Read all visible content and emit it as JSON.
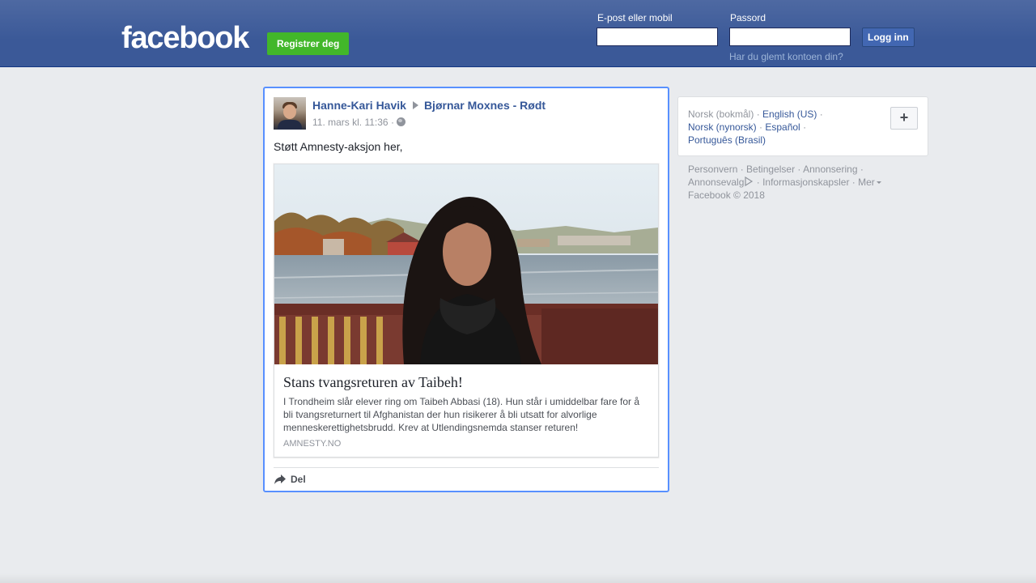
{
  "header": {
    "logo_text": "facebook",
    "register_label": "Registrer deg",
    "email_label": "E-post eller mobil",
    "email_value": "",
    "password_label": "Passord",
    "password_value": "",
    "login_label": "Logg inn",
    "forgot_label": "Har du glemt kontoen din?"
  },
  "post": {
    "author": "Hanne-Kari Havik",
    "target": "Bjørnar Moxnes - Rødt",
    "timestamp": "11. mars kl. 11:36",
    "meta_separator": "·",
    "text": "Støtt Amnesty-aksjon her,",
    "link": {
      "title": "Stans tvangsreturen av Taibeh!",
      "description": "I Trondheim slår elever ring om Taibeh Abbasi (18). Hun står i umiddelbar fare for å bli tvangsreturnert til Afghanistan der hun risikerer å bli utsatt for alvorlige menneskerettighetsbrudd. Krev at Utlendingsnemda stanser returen!",
      "domain": "AMNESTY.NO"
    },
    "share_label": "Del"
  },
  "languages": {
    "current": "Norsk (bokmål)",
    "others": [
      "English (US)",
      "Norsk (nynorsk)",
      "Español",
      "Português (Brasil)"
    ],
    "add_label": "+"
  },
  "footer": {
    "links": [
      "Personvern",
      "Betingelser",
      "Annonsering",
      "Annonsevalg",
      "Informasjonskapsler",
      "Mer"
    ],
    "copyright": "Facebook © 2018"
  },
  "colors": {
    "brand_blue": "#3b5998",
    "link_blue": "#365899",
    "register_green": "#42b72a",
    "focus_border": "#5890ff"
  }
}
